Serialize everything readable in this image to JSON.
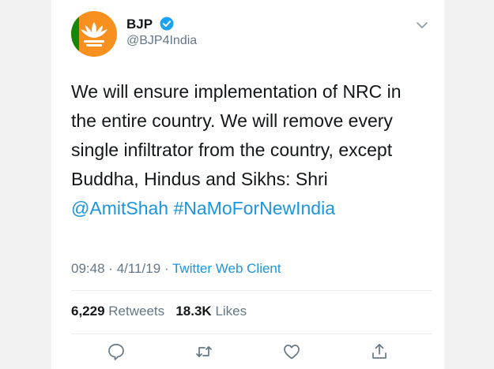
{
  "author": {
    "name": "BJP",
    "handle": "@BJP4India",
    "avatar_icon": "lotus-logo",
    "verified": true
  },
  "tweet": {
    "line1": "We will ensure implementation of NRC in",
    "line2": "the entire country. We will remove every",
    "line3": "single infiltrator from the country, except",
    "line4": "Buddha, Hindus and Sikhs: Shri",
    "mention": "@AmitShah",
    "hashtag": "#NaMoForNewIndia"
  },
  "meta": {
    "time": "09:48",
    "date": "4/11/19",
    "separator": "·",
    "client": "Twitter Web Client"
  },
  "stats": {
    "retweets_count": "6,229",
    "retweets_label": "Retweets",
    "likes_count": "18.3K",
    "likes_label": "Likes"
  },
  "actions": [
    "reply-icon",
    "retweet-icon",
    "like-icon",
    "share-icon"
  ],
  "colors": {
    "link": "#1b95e0",
    "text": "#14171a",
    "muted": "#657786",
    "avatar_bg": "#f7901e",
    "verified": "#1da1f2"
  }
}
